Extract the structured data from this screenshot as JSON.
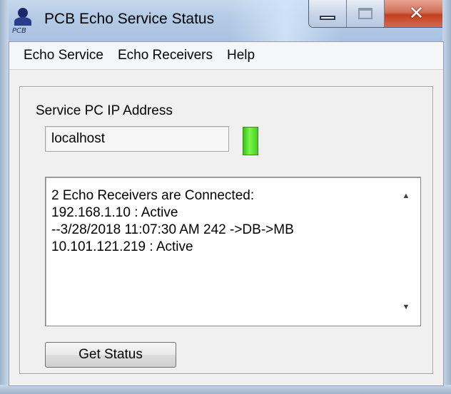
{
  "window": {
    "title": "PCB Echo Service Status",
    "icon": "pcb-app-icon",
    "controls": {
      "minimize": "minimize-icon",
      "maximize": "maximize-icon",
      "close": "close-icon",
      "close_glyph": "✕"
    }
  },
  "menu": {
    "items": [
      {
        "label": "Echo Service"
      },
      {
        "label": "Echo Receivers"
      },
      {
        "label": "Help"
      }
    ]
  },
  "service": {
    "ip_label": "Service PC IP Address",
    "ip_value": "localhost",
    "status_indicator_color": "#39c21a"
  },
  "status": {
    "lines": [
      "2 Echo Receivers are Connected:",
      "192.168.1.10 : Active",
      "--3/28/2018 11:07:30 AM 242 ->DB->MB",
      "10.101.121.219 : Active"
    ],
    "scroll_up": "▲",
    "scroll_down": "▼"
  },
  "actions": {
    "get_status_label": "Get Status"
  }
}
